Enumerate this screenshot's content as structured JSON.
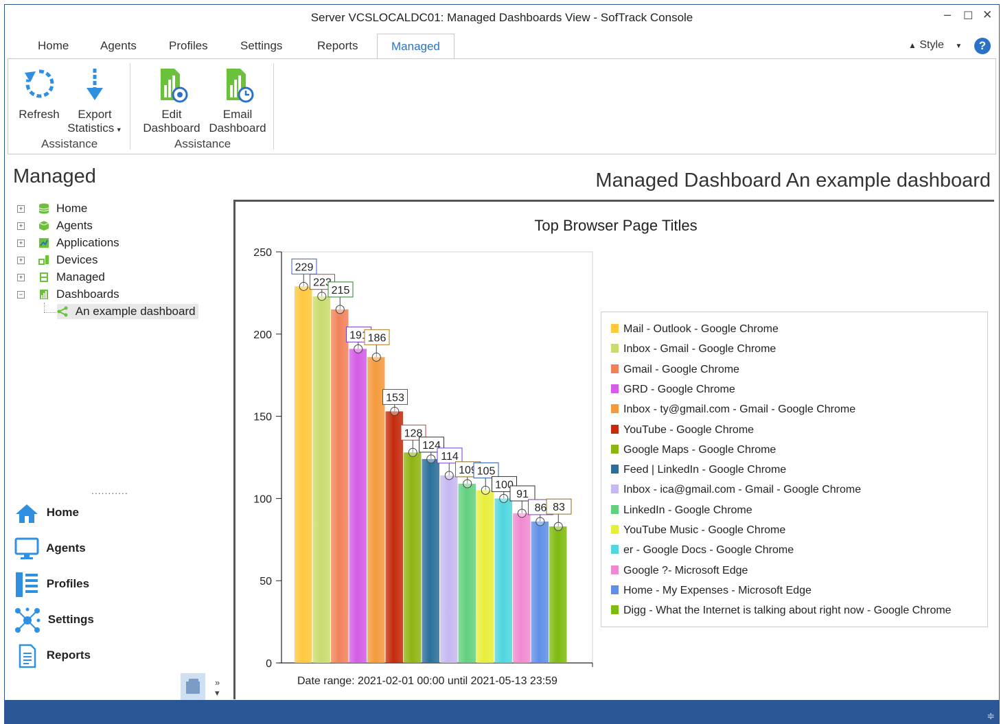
{
  "window": {
    "title": "Server VCSLOCALDC01: Managed Dashboards View - SofTrack Console",
    "controls": [
      "–",
      "☐",
      "✕"
    ]
  },
  "tabs": [
    {
      "label": "Home"
    },
    {
      "label": "Agents"
    },
    {
      "label": "Profiles"
    },
    {
      "label": "Settings"
    },
    {
      "label": "Reports"
    },
    {
      "label": "Managed",
      "active": true
    }
  ],
  "style_menu": {
    "label": "Style"
  },
  "ribbon": {
    "refresh": "Refresh",
    "export_line1": "Export",
    "export_line2": "Statistics",
    "edit_line1": "Edit",
    "edit_line2": "Dashboard",
    "email_line1": "Email",
    "email_line2": "Dashboard",
    "group1": "Assistance",
    "group2": "Assistance"
  },
  "leftpane": {
    "title": "Managed",
    "tree": [
      {
        "label": "Home",
        "icon": "database-icon"
      },
      {
        "label": "Agents",
        "icon": "cube-icon"
      },
      {
        "label": "Applications",
        "icon": "applications-icon"
      },
      {
        "label": "Devices",
        "icon": "devices-icon"
      },
      {
        "label": "Managed",
        "icon": "managed-icon"
      },
      {
        "label": "Dashboards",
        "icon": "dashboard-icon"
      },
      {
        "label": "An example dashboard",
        "icon": "share-icon"
      }
    ],
    "nav": [
      {
        "label": "Home",
        "icon": "house-icon"
      },
      {
        "label": "Agents",
        "icon": "monitor-icon"
      },
      {
        "label": "Profiles",
        "icon": "profiles-icon"
      },
      {
        "label": "Settings",
        "icon": "network-icon"
      },
      {
        "label": "Reports",
        "icon": "document-icon"
      }
    ]
  },
  "main": {
    "title": "Managed Dashboard An example dashboard"
  },
  "chart_data": {
    "type": "bar",
    "title": "Top Browser Page Titles",
    "xlabel": "Date range: 2021-02-01 00:00 until 2021-05-13 23:59",
    "ylabel": "",
    "ylim": [
      0,
      250
    ],
    "yticks": [
      0,
      50,
      100,
      150,
      200,
      250
    ],
    "legend_position": "right",
    "categories": [
      "Mail - Outlook - Google Chrome",
      "Inbox - Gmail - Google Chrome",
      "Gmail - Google Chrome",
      "GRD - Google Chrome",
      "Inbox - ty@gmail.com - Gmail - Google Chrome",
      "YouTube - Google Chrome",
      "Google Maps - Google Chrome",
      "Feed | LinkedIn - Google Chrome",
      "Inbox - ica@gmail.com - Gmail - Google Chrome",
      "LinkedIn - Google Chrome",
      "YouTube Music - Google Chrome",
      "er - Google Docs - Google Chrome",
      "Google ?- Microsoft Edge",
      "Home - My Expenses - Microsoft Edge",
      "Digg - What the Internet is talking about right now - Google Chrome"
    ],
    "values": [
      229,
      223,
      215,
      191,
      186,
      153,
      128,
      124,
      114,
      109,
      105,
      100,
      91,
      86,
      83
    ],
    "colors": [
      "#ffc83d",
      "#c9dc6e",
      "#f0825a",
      "#d45ce6",
      "#f49a3c",
      "#c42a0c",
      "#8fb412",
      "#2a6f9a",
      "#c6b8f0",
      "#62d07e",
      "#e7ee3a",
      "#4fd6de",
      "#f08ad0",
      "#5f8fe6",
      "#7fba10"
    ],
    "label_borders": [
      "#3a5fc8",
      "#c83a3a",
      "#2f7f2f",
      "#7a3ac8",
      "#b47a1a",
      "#2a5ab4",
      "#c83a3a",
      "#2f2f2f",
      "#7a3ac8",
      "#8a6a1a",
      "#2a5ab4",
      "#2f2f2f",
      "#2f2f2f",
      "#7a3ac8",
      "#8a6a1a"
    ]
  }
}
